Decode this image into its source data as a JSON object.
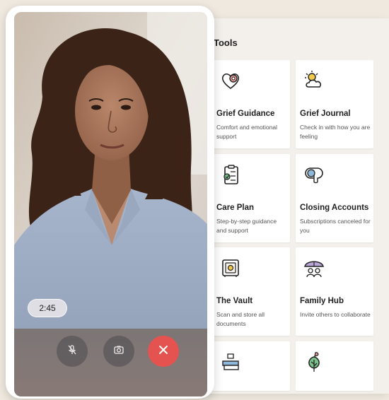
{
  "tools": {
    "title": "Tools",
    "cards": [
      {
        "title": "Grief Guidance",
        "desc": "Comfort and emotional support",
        "icon": "heart-pin-icon"
      },
      {
        "title": "Grief Journal",
        "desc": "Check in with how you are feeling",
        "icon": "sun-cloud-icon"
      },
      {
        "title": "Care Plan",
        "desc": "Step-by-step guidance and support",
        "icon": "clipboard-check-icon"
      },
      {
        "title": "Closing Accounts",
        "desc": "Subscriptions canceled for you",
        "icon": "toggle-hand-icon"
      },
      {
        "title": "The Vault",
        "desc": "Scan and store all documents",
        "icon": "safe-icon"
      },
      {
        "title": "Family Hub",
        "desc": "Invite others to collaborate",
        "icon": "family-umbrella-icon"
      },
      {
        "title": "",
        "desc": "",
        "icon": "tea-books-icon"
      },
      {
        "title": "",
        "desc": "",
        "icon": "bird-tree-icon"
      }
    ]
  },
  "call": {
    "timer": "2:45",
    "mute_icon": "mic-off-icon",
    "camera_icon": "camera-icon",
    "end_icon": "end-call-icon",
    "colors": {
      "end_call": "#e4534f",
      "accent": "#e89a95"
    }
  }
}
